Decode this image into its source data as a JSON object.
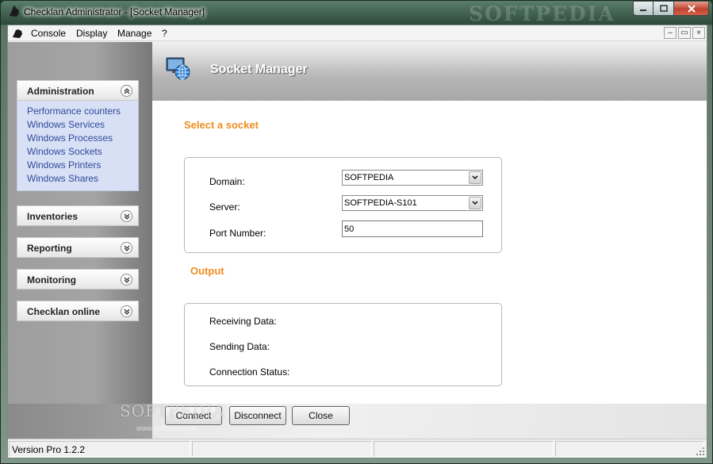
{
  "window": {
    "title": "Checklan Administrator - [Socket Manager]",
    "watermark": "SOFTPEDIA",
    "minimize_glyph": "0",
    "maximize_glyph": "1",
    "close_glyph": "r"
  },
  "menu": {
    "items": [
      "Console",
      "Display",
      "Manage",
      "?"
    ],
    "mdi_buttons": [
      "–",
      "▭",
      "×"
    ]
  },
  "sidebar": {
    "groups": [
      {
        "label": "Administration",
        "expanded": true,
        "items": [
          "Performance counters",
          "Windows Services",
          "Windows Processes",
          "Windows Sockets",
          "Windows Printers",
          "Windows Shares"
        ]
      },
      {
        "label": "Inventories",
        "expanded": false
      },
      {
        "label": "Reporting",
        "expanded": false
      },
      {
        "label": "Monitoring",
        "expanded": false
      },
      {
        "label": "Checklan online",
        "expanded": false
      }
    ]
  },
  "content": {
    "title": "Socket Manager",
    "select_section": {
      "title": "Select a socket",
      "domain_label": "Domain:",
      "domain_value": "SOFTPEDIA",
      "server_label": "Server:",
      "server_value": "SOFTPEDIA-S101",
      "port_label": "Port Number:",
      "port_value": "50"
    },
    "output_section": {
      "title": "Output",
      "receiving_label": "Receiving Data:",
      "sending_label": "Sending Data:",
      "status_label": "Connection Status:"
    }
  },
  "buttons": {
    "connect": "Connect",
    "disconnect": "Disconnect",
    "close": "Close"
  },
  "watermark_bottom": {
    "main": "SOFTPEDIA",
    "small": "www.softpedia.com"
  },
  "statusbar": {
    "version": "Version Pro 1.2.2"
  },
  "colors": {
    "accent_orange": "#f08c1e",
    "link_blue": "#2f4a9a",
    "sidebar_body": "#d8e0f5"
  }
}
